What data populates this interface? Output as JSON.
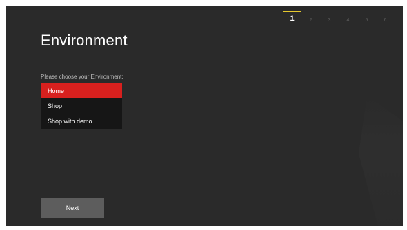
{
  "wizard": {
    "steps": [
      "1",
      "2",
      "3",
      "4",
      "5",
      "6"
    ],
    "active_step": "1"
  },
  "page": {
    "title": "Environment",
    "prompt": "Please choose your Environment:"
  },
  "environments": {
    "options": [
      "Home",
      "Shop",
      "Shop with demo"
    ],
    "selected": "Home"
  },
  "actions": {
    "next_label": "Next"
  },
  "colors": {
    "background": "#2a2a2a",
    "selection": "#d8201e",
    "active_step_underline": "#e6c92e",
    "button": "#5d5d5d"
  }
}
